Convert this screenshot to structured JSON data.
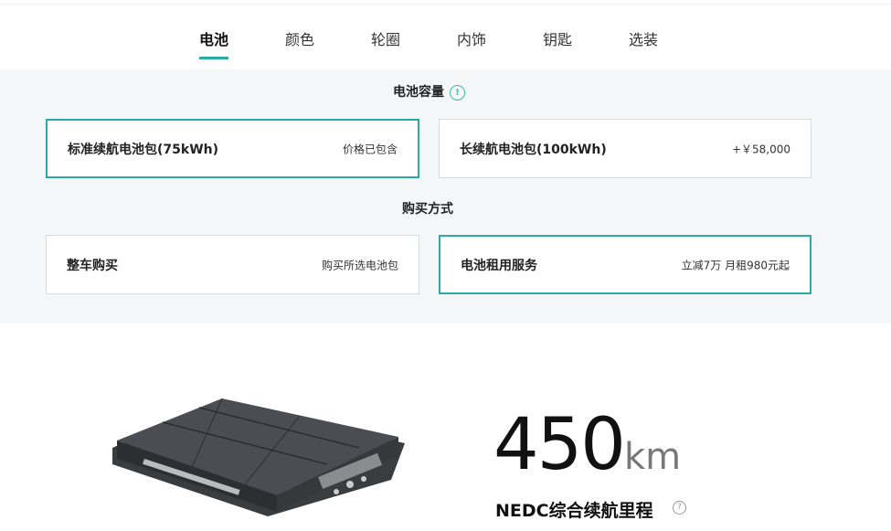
{
  "tabs": [
    {
      "label": "电池",
      "active": true
    },
    {
      "label": "颜色"
    },
    {
      "label": "轮圈"
    },
    {
      "label": "内饰"
    },
    {
      "label": "钥匙"
    },
    {
      "label": "选装"
    }
  ],
  "battery_capacity": {
    "title": "电池容量",
    "info_icon": "info-circle-icon",
    "options": [
      {
        "name": "标准续航电池包(75kWh)",
        "price": "价格已包含",
        "selected": true
      },
      {
        "name": "长续航电池包(100kWh)",
        "price": "+￥58,000",
        "selected": false
      }
    ]
  },
  "purchase_method": {
    "title": "购买方式",
    "options": [
      {
        "name": "整车购买",
        "price": "购买所选电池包",
        "selected": false
      },
      {
        "name": "电池租用服务",
        "price": "立减7万 月租980元起",
        "selected": true
      }
    ]
  },
  "range": {
    "value": "450",
    "unit": "km",
    "label": "NEDC综合续航里程"
  },
  "colors": {
    "accent": "#2aa9a5",
    "panel_bg": "#f5f6f7"
  }
}
